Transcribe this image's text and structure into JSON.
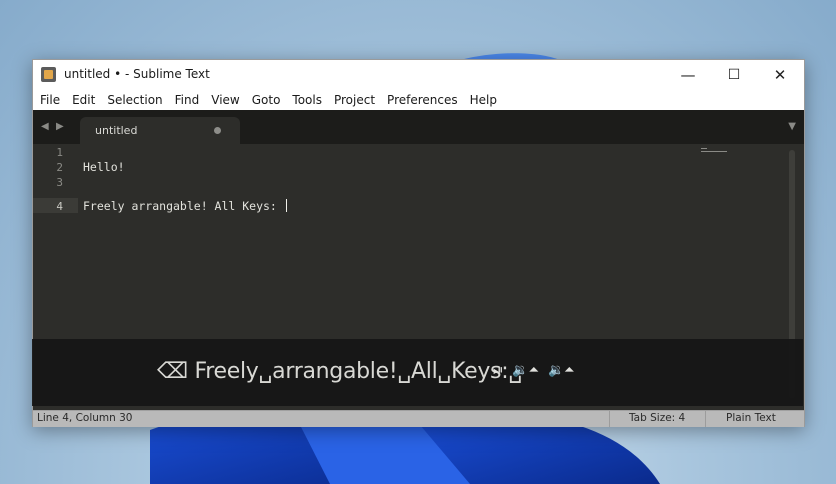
{
  "window": {
    "title": "untitled • - Sublime Text",
    "minimize": "—",
    "maximize": "☐",
    "close": "✕"
  },
  "menu": [
    "File",
    "Edit",
    "Selection",
    "Find",
    "View",
    "Goto",
    "Tools",
    "Project",
    "Preferences",
    "Help"
  ],
  "tabbar": {
    "back": "◀",
    "forward": "▶",
    "tab_label": "untitled",
    "dropdown": "▼"
  },
  "editor": {
    "line_numbers": [
      "1",
      "2",
      "3",
      "4"
    ],
    "lines": [
      "",
      "Hello!",
      "",
      "Freely arrangable! All Keys: "
    ],
    "current_line": 4
  },
  "keystroke_overlay": {
    "text": "⌫ Freely␣arrangable!␣All␣Keys:␣",
    "icons": [
      "⏯",
      "🔉⏶",
      "🔉⏶"
    ]
  },
  "statusbar": {
    "position": "Line 4, Column 30",
    "tab_size": "Tab Size: 4",
    "syntax": "Plain Text"
  },
  "colors": {
    "editor_bg": "#2d2d2a",
    "tabbar_bg": "#1c1c1a",
    "statusbar_bg": "#b9b9b9"
  }
}
